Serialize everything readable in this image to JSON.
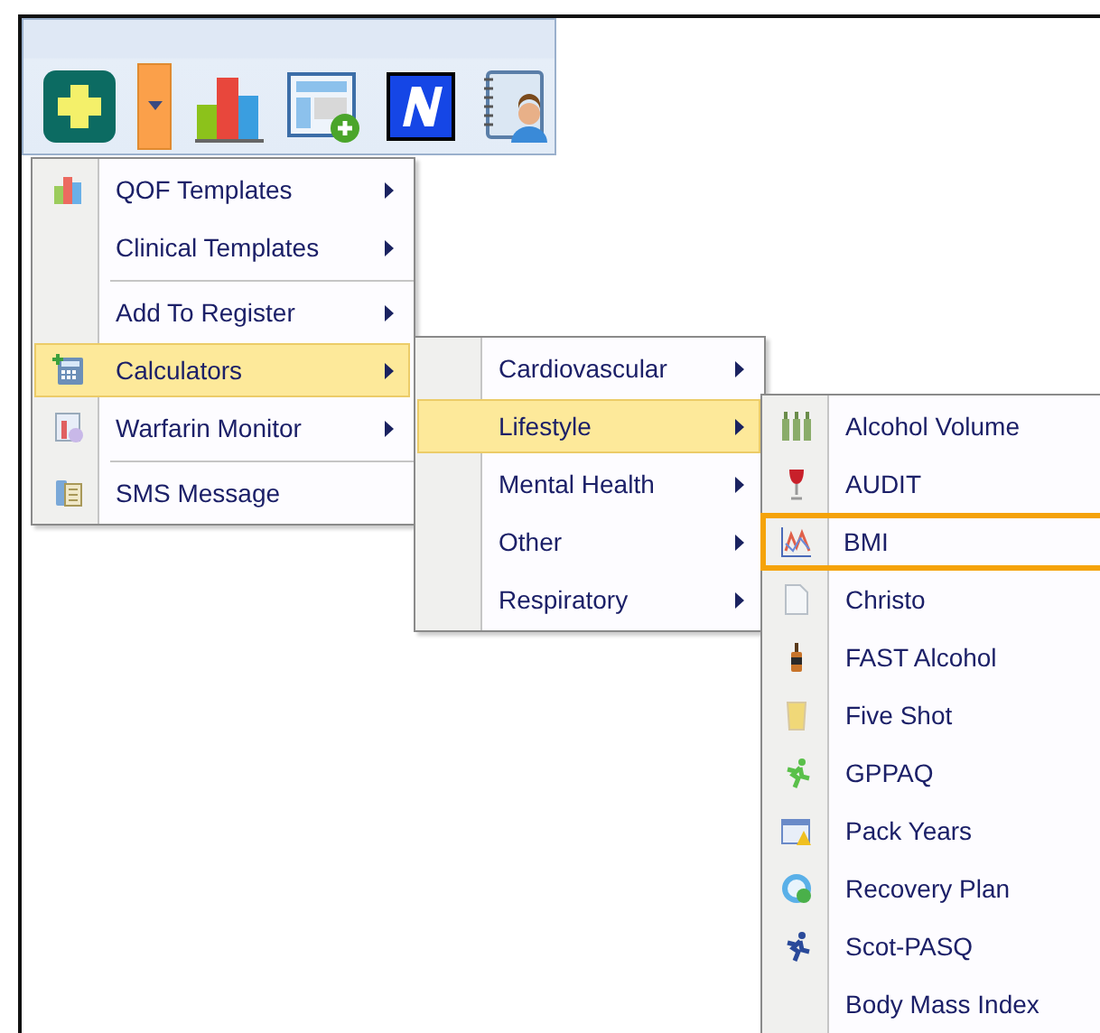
{
  "toolbar": {
    "buttons": [
      {
        "kind": "add",
        "selected": false
      },
      {
        "kind": "dropdown",
        "selected": true
      },
      {
        "kind": "chart",
        "selected": false
      },
      {
        "kind": "template",
        "selected": false
      },
      {
        "kind": "letter",
        "selected": false
      },
      {
        "kind": "contact",
        "selected": false
      }
    ]
  },
  "menu": {
    "items": [
      {
        "label": "QOF Templates",
        "kind": "chart",
        "submenu": true,
        "selected": false,
        "divider_above": false
      },
      {
        "label": "Clinical Templates",
        "kind": "plain",
        "submenu": true,
        "selected": false,
        "divider_above": false
      },
      {
        "label": "Add To Register",
        "kind": "plain",
        "submenu": true,
        "selected": false,
        "divider_above": true
      },
      {
        "label": "Calculators",
        "kind": "calculator",
        "submenu": true,
        "selected": true,
        "divider_above": false
      },
      {
        "label": "Warfarin Monitor",
        "kind": "monitor",
        "submenu": true,
        "selected": false,
        "divider_above": false
      },
      {
        "label": "SMS Message",
        "kind": "phone",
        "submenu": false,
        "selected": false,
        "divider_above": true
      }
    ]
  },
  "calculators_menu": {
    "items": [
      {
        "label": "Cardiovascular",
        "submenu": true,
        "selected": false
      },
      {
        "label": "Lifestyle",
        "submenu": true,
        "selected": true
      },
      {
        "label": "Mental Health",
        "submenu": true,
        "selected": false
      },
      {
        "label": "Other",
        "submenu": true,
        "selected": false
      },
      {
        "label": "Respiratory",
        "submenu": true,
        "selected": false
      }
    ]
  },
  "lifestyle_menu": {
    "items": [
      {
        "label": "Alcohol Volume",
        "kind": "bottles",
        "highlighted": false
      },
      {
        "label": "AUDIT",
        "kind": "wine",
        "highlighted": false
      },
      {
        "label": "BMI",
        "kind": "graph",
        "highlighted": true
      },
      {
        "label": "Christo",
        "kind": "document",
        "highlighted": false
      },
      {
        "label": "FAST Alcohol",
        "kind": "bottle",
        "highlighted": false
      },
      {
        "label": "Five Shot",
        "kind": "glass",
        "highlighted": false
      },
      {
        "label": "GPPAQ",
        "kind": "runner",
        "highlighted": false
      },
      {
        "label": "Pack Years",
        "kind": "calendar",
        "highlighted": false
      },
      {
        "label": "Recovery Plan",
        "kind": "clock",
        "highlighted": false
      },
      {
        "label": "Scot-PASQ",
        "kind": "runner-dark",
        "highlighted": false
      },
      {
        "label": "Body Mass Index",
        "kind": "plain",
        "highlighted": false
      }
    ]
  }
}
